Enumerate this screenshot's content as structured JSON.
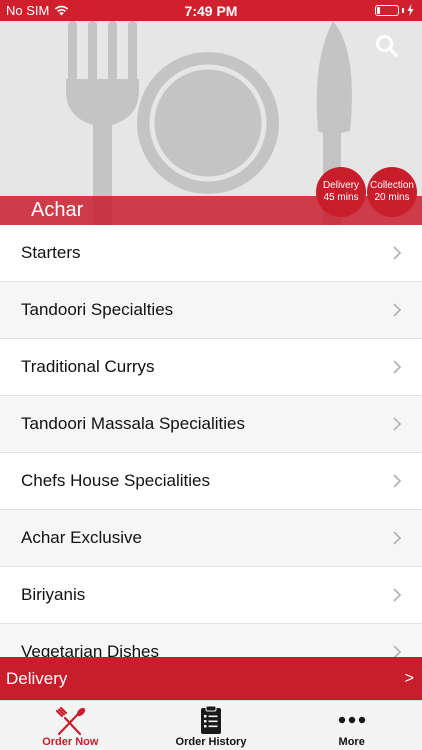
{
  "status_bar": {
    "carrier": "No SIM",
    "time": "7:49 PM"
  },
  "restaurant": {
    "name": "Achar"
  },
  "badges": {
    "delivery_title": "Delivery",
    "delivery_time": "45 mins",
    "collection_title": "Collection",
    "collection_time": "20 mins"
  },
  "categories": [
    {
      "label": "Starters"
    },
    {
      "label": "Tandoori Specialties"
    },
    {
      "label": "Traditional Currys"
    },
    {
      "label": "Tandoori Massala Specialities"
    },
    {
      "label": "Chefs House Specialities"
    },
    {
      "label": "Achar Exclusive"
    },
    {
      "label": "Biriyanis"
    },
    {
      "label": "Vegetarian Dishes"
    }
  ],
  "delivery_bar": {
    "label": "Delivery",
    "arrow": ">"
  },
  "tabs": [
    {
      "label": "Order Now",
      "icon": "fork-knife-icon"
    },
    {
      "label": "Order History",
      "icon": "clipboard-icon"
    },
    {
      "label": "More",
      "icon": "more-dots-icon"
    }
  ],
  "colors": {
    "brand_red": "#c81d2b",
    "status_bar_red": "#d0202e"
  }
}
